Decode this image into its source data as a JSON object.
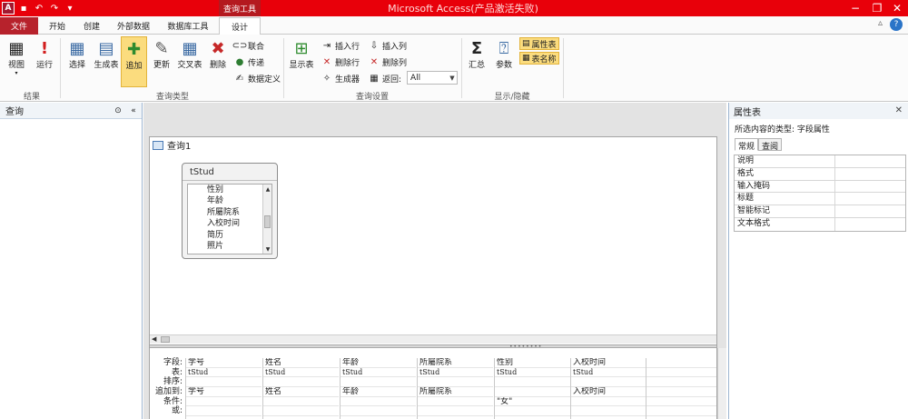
{
  "titlebar": {
    "context_tab": "查询工具",
    "window_title": "Microsoft Access(产品激活失败)",
    "minimize": "−",
    "restore": "❐",
    "close": "✕"
  },
  "tabs": {
    "file": "文件",
    "home": "开始",
    "create": "创建",
    "external": "外部数据",
    "dbtools": "数据库工具",
    "design": "设计"
  },
  "ribbon": {
    "results": {
      "view": "视图",
      "run": "运行",
      "label": "结果"
    },
    "query_type": {
      "select": "选择",
      "make_table": "生成表",
      "append": "追加",
      "update": "更新",
      "crosstab": "交叉表",
      "delete": "删除",
      "union": "联合",
      "passthrough": "传递",
      "data_definition": "数据定义",
      "label": "查询类型"
    },
    "query_setup": {
      "show_table": "显示表",
      "insert_rows": "插入行",
      "delete_rows": "删除行",
      "builder": "生成器",
      "insert_columns": "插入列",
      "delete_columns": "删除列",
      "return_label": "返回:",
      "return_value": "All",
      "label": "查询设置"
    },
    "show_hide": {
      "totals": "汇总",
      "parameters": "参数",
      "property_sheet": "属性表",
      "table_names": "表名称",
      "label": "显示/隐藏"
    }
  },
  "nav": {
    "title": "查询"
  },
  "query": {
    "title": "查询1",
    "table": {
      "name": "tStud",
      "fields": [
        "性别",
        "年龄",
        "所屬院系",
        "入校时间",
        "简历",
        "照片"
      ]
    },
    "grid": {
      "row_labels": [
        "字段:",
        "表:",
        "排序:",
        "追加到:",
        "条件:",
        "或:"
      ],
      "columns": [
        {
          "field": "学号",
          "table": "tStud",
          "sort": "",
          "append_to": "学号",
          "criteria": ""
        },
        {
          "field": "姓名",
          "table": "tStud",
          "sort": "",
          "append_to": "姓名",
          "criteria": ""
        },
        {
          "field": "年龄",
          "table": "tStud",
          "sort": "",
          "append_to": "年龄",
          "criteria": ""
        },
        {
          "field": "所屬院系",
          "table": "tStud",
          "sort": "",
          "append_to": "所屬院系",
          "criteria": ""
        },
        {
          "field": "性别",
          "table": "tStud",
          "sort": "",
          "append_to": "",
          "criteria": "\"女\""
        },
        {
          "field": "入校时间",
          "table": "tStud",
          "sort": "",
          "append_to": "入校时间",
          "criteria": ""
        }
      ]
    }
  },
  "props": {
    "title": "属性表",
    "selection_type": "所选内容的类型: 字段属性",
    "tab_general": "常规",
    "tab_lookup": "查阅",
    "rows": [
      "说明",
      "格式",
      "输入掩码",
      "标题",
      "智能标记",
      "文本格式"
    ]
  }
}
